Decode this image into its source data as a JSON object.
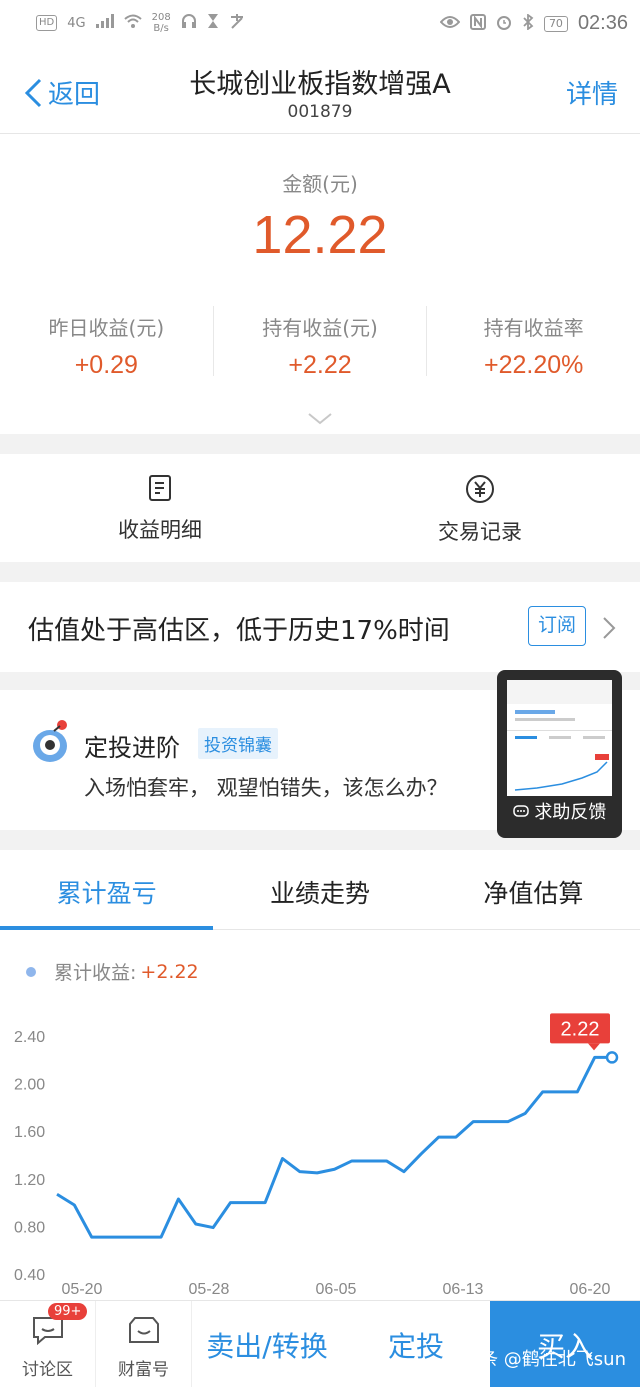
{
  "status_bar": {
    "left_chip": "HD",
    "network": "4G",
    "speed_value": "208",
    "speed_unit": "B/s",
    "battery": "70",
    "time": "02:36"
  },
  "nav": {
    "back_label": "返回",
    "title": "长城创业板指数增强A",
    "code": "001879",
    "detail_label": "详情"
  },
  "summary": {
    "amount_label": "金额(元)",
    "amount_value": "12.22",
    "stats": [
      {
        "label": "昨日收益(元)",
        "value": "+0.29"
      },
      {
        "label": "持有收益(元)",
        "value": "+2.22"
      },
      {
        "label": "持有收益率",
        "value": "+22.20%"
      }
    ]
  },
  "actions": [
    {
      "label": "收益明细",
      "icon": "document-icon"
    },
    {
      "label": "交易记录",
      "icon": "yen-circle-icon"
    }
  ],
  "valuation": {
    "text": "估值处于高估区，低于历史17%时间",
    "subscribe_label": "订阅"
  },
  "invest": {
    "title": "定投进阶",
    "tag": "投资锦囊",
    "subtitle": "入场怕套牢， 观望怕错失，该怎么办？"
  },
  "feedback": {
    "label": "求助反馈"
  },
  "tabs": [
    {
      "label": "累计盈亏",
      "active": true
    },
    {
      "label": "业绩走势",
      "active": false
    },
    {
      "label": "净值估算",
      "active": false
    }
  ],
  "legend": {
    "label": "累计收益:",
    "value": "+2.22"
  },
  "chart_data": {
    "type": "line",
    "title": "",
    "xlabel": "",
    "ylabel": "",
    "ylim": [
      0.4,
      2.4
    ],
    "yticks": [
      "2.40",
      "2.00",
      "1.60",
      "1.20",
      "0.80",
      "0.40"
    ],
    "xticks": [
      "05-20",
      "05-28",
      "06-05",
      "06-13",
      "06-20"
    ],
    "series": [
      {
        "values": [
          1.07,
          0.98,
          0.71,
          0.71,
          0.71,
          0.71,
          0.71,
          1.03,
          0.82,
          0.79,
          1.0,
          1.0,
          1.0,
          1.37,
          1.26,
          1.25,
          1.28,
          1.35,
          1.35,
          1.35,
          1.26,
          1.41,
          1.55,
          1.55,
          1.68,
          1.68,
          1.68,
          1.75,
          1.93,
          1.93,
          1.93,
          2.22,
          2.22
        ]
      }
    ],
    "end_label": "2.22",
    "line_color": "#2b8ee0"
  },
  "bottom_bar": {
    "discuss_label": "讨论区",
    "discuss_badge": "99+",
    "wealth_label": "财富号",
    "sell_label": "卖出/转换",
    "fixed_label": "定投",
    "buy_label": "买入",
    "watermark": "头条 @鹤往北飞sun"
  }
}
